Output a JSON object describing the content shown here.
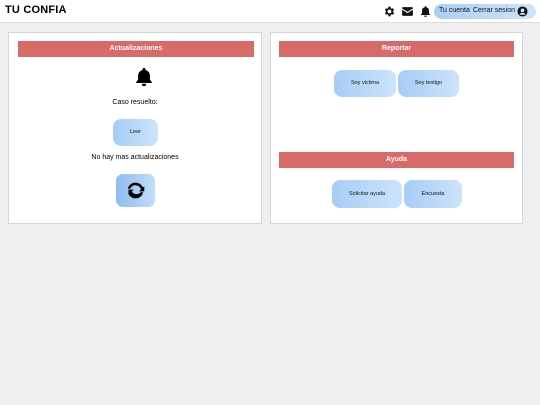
{
  "navbar": {
    "brand": "TU CONFIA",
    "icons": [
      "gear-icon",
      "envelope-icon",
      "bell-icon"
    ],
    "account_label": "Tu cuenta",
    "logout_label": "Cerrar sesion"
  },
  "updates": {
    "header": "Actualizaciones",
    "case_text": "Caso resuelto:",
    "read_button": "Leer",
    "no_updates_text": "No hay mas actualizaciones"
  },
  "report": {
    "header": "Reportar",
    "victim_button": "Soy victima",
    "witness_button": "Soy testigo"
  },
  "help": {
    "header": "Ayuda",
    "request_button": "Solicitar ayuda",
    "survey_button": "Encuesta"
  },
  "colors": {
    "header_red": "#d96a6a",
    "button_blue": "#a6cdf6"
  }
}
